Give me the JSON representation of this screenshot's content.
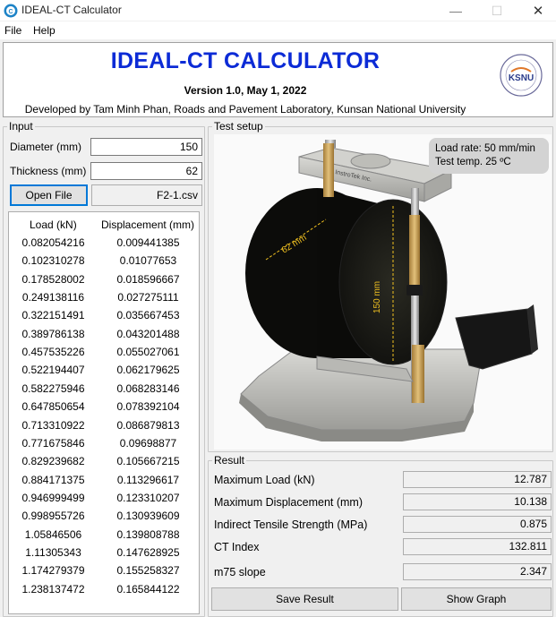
{
  "window": {
    "title": "IDEAL-CT Calculator",
    "minimize_glyph": "—",
    "maximize_glyph": "☐",
    "close_glyph": "✕"
  },
  "menu": {
    "file": "File",
    "help": "Help"
  },
  "header": {
    "title": "IDEAL-CT CALCULATOR",
    "version": "Version 1.0, May 1, 2022",
    "developer": "Developed by Tam Minh Phan, Roads and Pavement Laboratory, Kunsan National University",
    "logo_text": "KSNU"
  },
  "input": {
    "group_label": "Input",
    "diameter_label": "Diameter (mm)",
    "diameter_value": "150",
    "thickness_label": "Thickness (mm)",
    "thickness_value": "62",
    "open_file_label": "Open File",
    "file_name": "F2-1.csv",
    "table": {
      "headers": [
        "Load (kN)",
        "Displacement (mm)"
      ],
      "rows": [
        [
          "0.082054216",
          "0.009441385"
        ],
        [
          "0.102310278",
          "0.01077653"
        ],
        [
          "0.178528002",
          "0.018596667"
        ],
        [
          "0.249138116",
          "0.027275111"
        ],
        [
          "0.322151491",
          "0.035667453"
        ],
        [
          "0.389786138",
          "0.043201488"
        ],
        [
          "0.457535226",
          "0.055027061"
        ],
        [
          "0.522194407",
          "0.062179625"
        ],
        [
          "0.582275946",
          "0.068283146"
        ],
        [
          "0.647850654",
          "0.078392104"
        ],
        [
          "0.713310922",
          "0.086879813"
        ],
        [
          "0.771675846",
          "0.09698877"
        ],
        [
          "0.829239682",
          "0.105667215"
        ],
        [
          "0.884171375",
          "0.113296617"
        ],
        [
          "0.946999499",
          "0.123310207"
        ],
        [
          "0.998955726",
          "0.130939609"
        ],
        [
          "1.05846506",
          "0.139808788"
        ],
        [
          "1.11305343",
          "0.147628925"
        ],
        [
          "1.174279379",
          "0.155258327"
        ],
        [
          "1.238137472",
          "0.165844122"
        ]
      ]
    }
  },
  "test_setup": {
    "group_label": "Test setup",
    "load_rate": "Load rate: 50 mm/min",
    "test_temp": "Test temp. 25 ºC",
    "thickness_annotation": "62 mm",
    "diameter_annotation": "150 mm",
    "brand_text": "InstroTek Inc."
  },
  "result": {
    "group_label": "Result",
    "items": [
      {
        "label": "Maximum Load (kN)",
        "value": "12.787"
      },
      {
        "label": "Maximum Displacement (mm)",
        "value": "10.138"
      },
      {
        "label": "Indirect Tensile Strength (MPa)",
        "value": "0.875"
      },
      {
        "label": "CT Index",
        "value": "132.811"
      },
      {
        "label": "m75 slope",
        "value": "2.347"
      }
    ],
    "save_label": "Save Result",
    "graph_label": "Show Graph"
  }
}
